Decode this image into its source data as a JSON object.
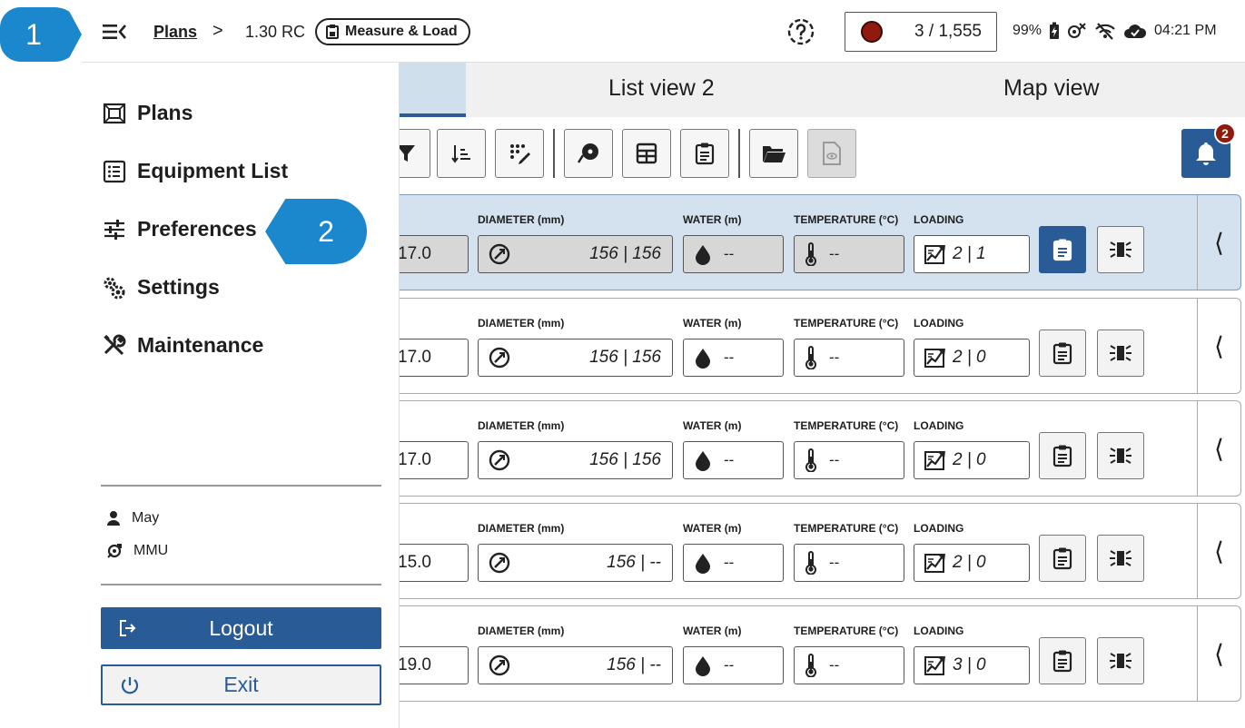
{
  "callouts": {
    "one": "1",
    "two": "2"
  },
  "header": {
    "breadcrumb_plans": "Plans",
    "breadcrumb_sep": ">",
    "breadcrumb_version": "1.30 RC",
    "mode_label": "Measure & Load",
    "counter": "3 / 1,555",
    "battery": "99%",
    "time": "04:21 PM"
  },
  "drawer": {
    "items": [
      {
        "label": "Plans",
        "icon": "plans-icon"
      },
      {
        "label": "Equipment List",
        "icon": "list-icon"
      },
      {
        "label": "Preferences",
        "icon": "sliders-icon"
      },
      {
        "label": "Settings",
        "icon": "gears-icon"
      },
      {
        "label": "Maintenance",
        "icon": "tools-icon"
      }
    ],
    "user_name": "May",
    "unit_name": "MMU",
    "logout_label": "Logout",
    "exit_label": "Exit"
  },
  "tabs": {
    "list_view_2": "List view 2",
    "map_view": "Map view"
  },
  "notifications": {
    "count": "2"
  },
  "columns": {
    "diameter": "DIAMETER (mm)",
    "water": "WATER (m)",
    "temperature": "TEMPERATURE (°C)",
    "loading": "LOADING"
  },
  "rows": [
    {
      "depth": "17.0",
      "diameter": "156 | 156",
      "water": "--",
      "temperature": "--",
      "loading": "2 | 1",
      "selected": true
    },
    {
      "depth": "17.0",
      "diameter": "156 | 156",
      "water": "--",
      "temperature": "--",
      "loading": "2 | 0",
      "selected": false
    },
    {
      "depth": "17.0",
      "diameter": "156 | 156",
      "water": "--",
      "temperature": "--",
      "loading": "2 | 0",
      "selected": false
    },
    {
      "depth": "15.0",
      "diameter": "156 | --",
      "water": "--",
      "temperature": "--",
      "loading": "2 | 0",
      "selected": false
    },
    {
      "depth": "19.0",
      "diameter": "156 | --",
      "water": "--",
      "temperature": "--",
      "loading": "3 | 0",
      "selected": false
    }
  ],
  "colors": {
    "primary": "#295b96",
    "callout": "#1b87cc",
    "alert": "#8f1b0e",
    "selected_row": "#d3e2ee"
  }
}
